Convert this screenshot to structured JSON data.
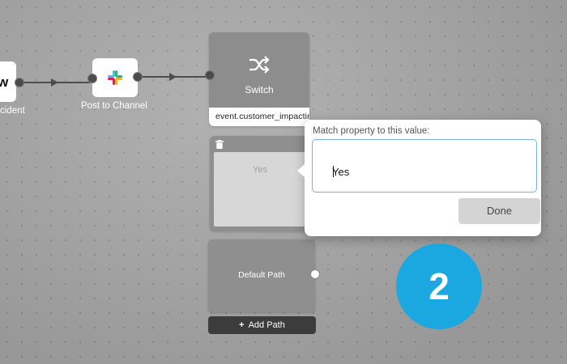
{
  "workflow": {
    "nodes": [
      {
        "label": "cident",
        "icon_text": "w"
      },
      {
        "label": "Post to Channel",
        "icon": "slack-logo-icon"
      }
    ],
    "switch": {
      "title": "Switch",
      "icon": "shuffle-icon",
      "property": "event.customer_impacting"
    },
    "paths": [
      {
        "label": "Yes",
        "icon": "trash-icon"
      },
      {
        "label": "Default Path"
      }
    ],
    "add_path_label": "Add Path",
    "add_path_icon": "+"
  },
  "popover": {
    "label": "Match property to this value:",
    "input_value": "Yes",
    "done_label": "Done",
    "accent_color": "#78b4d6"
  },
  "step_badge": {
    "number": "2",
    "color": "#1ba8e0"
  }
}
